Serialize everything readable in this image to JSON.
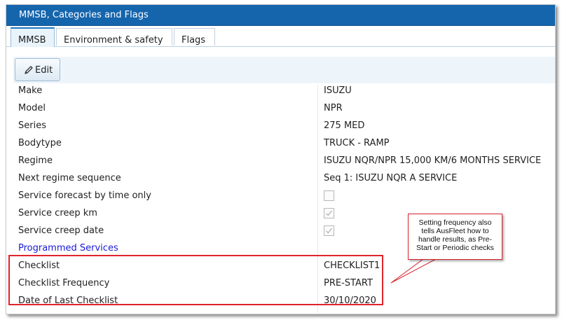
{
  "window": {
    "title": "MMSB, Categories and Flags"
  },
  "tabs": [
    {
      "label": "MMSB",
      "active": true
    },
    {
      "label": "Environment & safety",
      "active": false
    },
    {
      "label": "Flags",
      "active": false
    }
  ],
  "toolbar": {
    "edit_label": "Edit",
    "edit_icon": "pencil-icon"
  },
  "fields": {
    "make": {
      "label": "Make",
      "value": "ISUZU"
    },
    "model": {
      "label": "Model",
      "value": "NPR"
    },
    "series": {
      "label": "Series",
      "value": "275 MED"
    },
    "bodytype": {
      "label": "Bodytype",
      "value": "TRUCK - RAMP"
    },
    "regime": {
      "label": "Regime",
      "value": "ISUZU NQR/NPR 15,000 KM/6 MONTHS SERVICE"
    },
    "next_regime_sequence": {
      "label": "Next regime sequence",
      "value": "Seq 1: ISUZU NQR A SERVICE"
    },
    "service_forecast_by_time_only": {
      "label": "Service forecast by time only",
      "checked": false,
      "disabled": false
    },
    "service_creep_km": {
      "label": "Service creep km",
      "checked": true,
      "disabled": true
    },
    "service_creep_date": {
      "label": "Service creep date",
      "checked": true,
      "disabled": true
    },
    "programmed_services": {
      "label": "Programmed Services"
    },
    "checklist": {
      "label": "Checklist",
      "value": "CHECKLIST1"
    },
    "checklist_frequency": {
      "label": "Checklist Frequency",
      "value": "PRE-START"
    },
    "date_of_last_checklist": {
      "label": "Date of Last Checklist",
      "value": "30/10/2020"
    }
  },
  "annotation": {
    "text": "Setting frequency also tells AusFleet how to handle results, as Pre-Start or Periodic checks"
  },
  "colors": {
    "titlebar": "#1565ad",
    "highlight": "#e0242c",
    "link": "#1a1ad6",
    "active_tab_top": "#1e78c2"
  }
}
